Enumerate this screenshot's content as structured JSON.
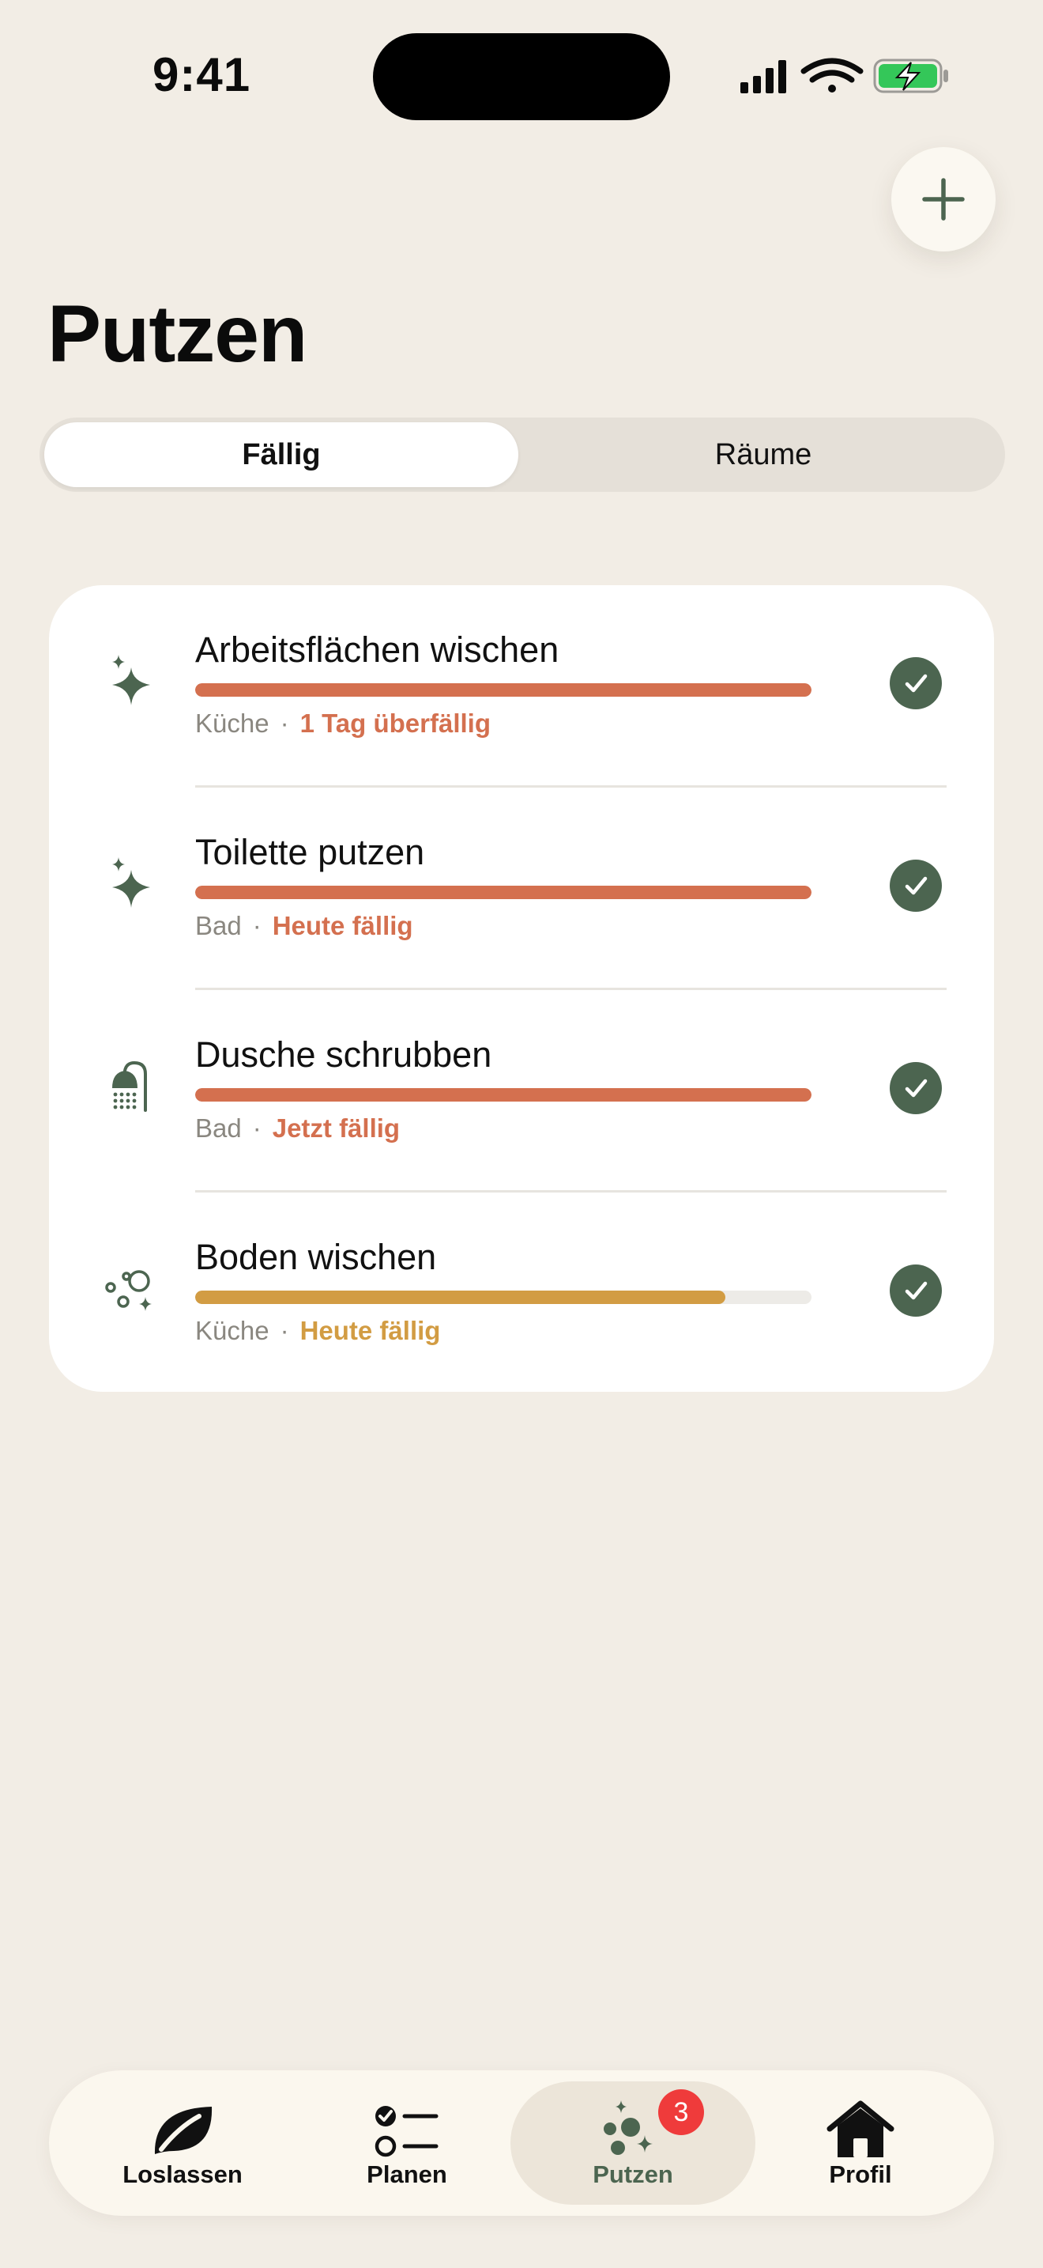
{
  "status_bar": {
    "time": "9:41"
  },
  "header": {
    "title": "Putzen",
    "add_icon": "plus-icon"
  },
  "segmented": {
    "options": [
      {
        "label": "Fällig",
        "selected": true
      },
      {
        "label": "Räume",
        "selected": false
      }
    ]
  },
  "tasks": [
    {
      "title": "Arbeitsflächen wischen",
      "room": "Küche",
      "status": "1 Tag überfällig",
      "status_color": "#D4704F",
      "progress": 1.0,
      "bar_color": "#D4704F",
      "icon": "sparkles-icon"
    },
    {
      "title": "Toilette putzen",
      "room": "Bad",
      "status": "Heute fällig",
      "status_color": "#D4704F",
      "progress": 1.0,
      "bar_color": "#D4704F",
      "icon": "sparkles-icon"
    },
    {
      "title": "Dusche schrubben",
      "room": "Bad",
      "status": "Jetzt fällig",
      "status_color": "#D4704F",
      "progress": 1.0,
      "bar_color": "#D4704F",
      "icon": "shower-icon"
    },
    {
      "title": "Boden wischen",
      "room": "Küche",
      "status": "Heute fällig",
      "status_color": "#D29C43",
      "progress": 0.86,
      "bar_color": "#D29C43",
      "icon": "bubbles-icon"
    }
  ],
  "separator": "·",
  "tab_bar": {
    "items": [
      {
        "label": "Loslassen",
        "icon": "leaf-icon",
        "selected": false
      },
      {
        "label": "Planen",
        "icon": "checklist-icon",
        "selected": false
      },
      {
        "label": "Putzen",
        "icon": "sparkle-bubbles-icon",
        "selected": true,
        "badge": "3"
      },
      {
        "label": "Profil",
        "icon": "house-icon",
        "selected": false
      }
    ]
  },
  "colors": {
    "background": "#F2EDE5",
    "accent_green": "#4C6550",
    "overdue": "#D4704F",
    "due": "#D29C43",
    "badge": "#EF3B3B"
  }
}
